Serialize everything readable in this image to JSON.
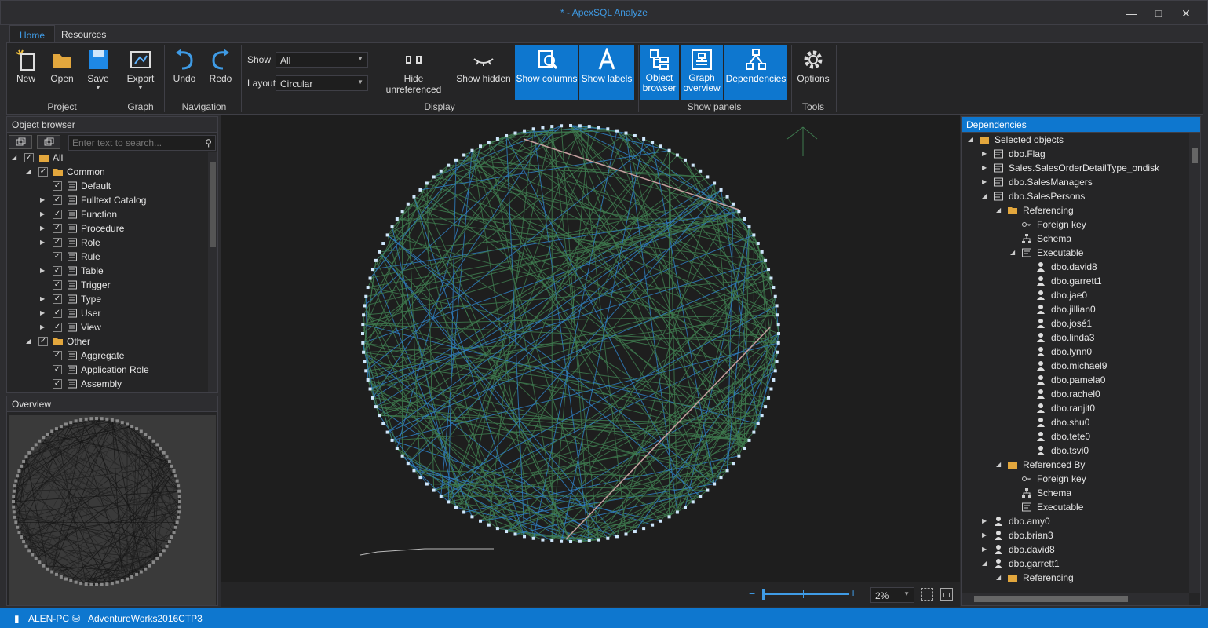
{
  "window": {
    "title": "* - ApexSQL Analyze"
  },
  "tabs": [
    "Home",
    "Resources"
  ],
  "ribbon": {
    "buttons": {
      "new": "New",
      "open": "Open",
      "save": "Save",
      "export": "Export",
      "undo": "Undo",
      "redo": "Redo",
      "hide_unreferenced": "Hide unreferenced",
      "show_hidden": "Show hidden",
      "show_columns": "Show columns",
      "show_labels": "Show labels",
      "object_browser_1": "Object",
      "object_browser_2": "browser",
      "graph_overview_1": "Graph",
      "graph_overview_2": "overview",
      "dependencies": "Dependencies",
      "options": "Options"
    },
    "show_label": "Show",
    "show_value": "All",
    "layout_label": "Layout",
    "layout_value": "Circular",
    "groups": {
      "project": "Project",
      "graph": "Graph",
      "navigation": "Navigation",
      "display": "Display",
      "show_panels": "Show panels",
      "tools": "Tools"
    }
  },
  "object_browser": {
    "title": "Object browser",
    "search_placeholder": "Enter text to search...",
    "items": [
      "All",
      "Common",
      "Default",
      "Fulltext Catalog",
      "Function",
      "Procedure",
      "Role",
      "Rule",
      "Table",
      "Trigger",
      "Type",
      "User",
      "View",
      "Other",
      "Aggregate",
      "Application Role",
      "Assembly"
    ]
  },
  "overview": {
    "title": "Overview"
  },
  "dependencies": {
    "title": "Dependencies",
    "items": [
      "Selected objects",
      "dbo.Flag",
      "Sales.SalesOrderDetailType_ondisk",
      "dbo.SalesManagers",
      "dbo.SalesPersons",
      "Referencing",
      "Foreign key",
      "Schema",
      "Executable",
      "dbo.david8",
      "dbo.garrett1",
      "dbo.jae0",
      "dbo.jillian0",
      "dbo.josé1",
      "dbo.linda3",
      "dbo.lynn0",
      "dbo.michael9",
      "dbo.pamela0",
      "dbo.rachel0",
      "dbo.ranjit0",
      "dbo.shu0",
      "dbo.tete0",
      "dbo.tsvi0",
      "Referenced By",
      "Foreign key",
      "Schema",
      "Executable",
      "dbo.amy0",
      "dbo.brian3",
      "dbo.david8",
      "dbo.garrett1",
      "Referencing"
    ]
  },
  "zoom": {
    "value": "2%"
  },
  "status": {
    "server": "ALEN-PC",
    "database": "AdventureWorks2016CTP3"
  },
  "colors": {
    "accent": "#0e77cf",
    "title": "#3f9be5",
    "edge_green": "#3e7a4f",
    "edge_blue": "#2f7fc1",
    "edge_pink": "#c7a0a0"
  }
}
